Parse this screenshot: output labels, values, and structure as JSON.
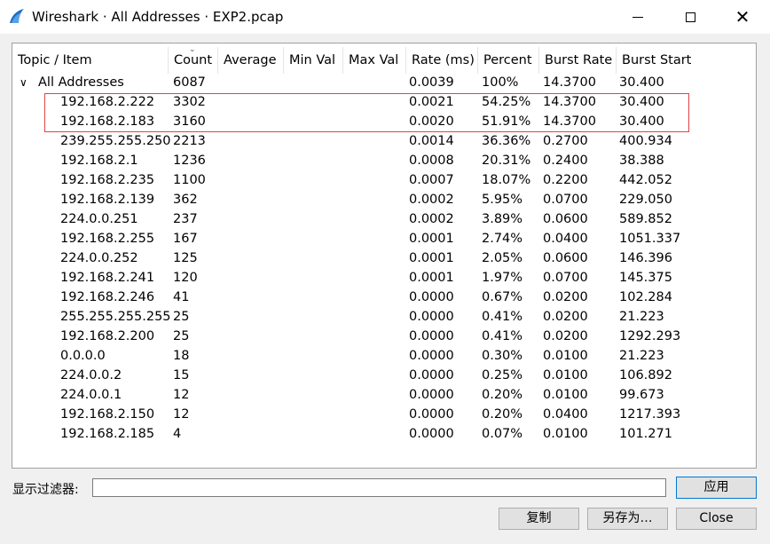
{
  "window": {
    "title": "Wireshark · All Addresses · EXP2.pcap",
    "icon": "wireshark-fin-icon",
    "controls": {
      "minimize": "minimize-icon",
      "maximize": "maximize-icon",
      "close_glyph": "✕"
    }
  },
  "table": {
    "columns": [
      "Topic / Item",
      "Count",
      "Average",
      "Min Val",
      "Max Val",
      "Rate (ms)",
      "Percent",
      "Burst Rate",
      "Burst Start"
    ],
    "root": {
      "expander": "∨",
      "item": "All Addresses",
      "count": "6087",
      "rate": "0.0039",
      "percent": "100%",
      "burst_rate": "14.3700",
      "burst_start": "30.400"
    },
    "rows": [
      {
        "item": "192.168.2.222",
        "count": "3302",
        "rate": "0.0021",
        "percent": "54.25%",
        "burst_rate": "14.3700",
        "burst_start": "30.400"
      },
      {
        "item": "192.168.2.183",
        "count": "3160",
        "rate": "0.0020",
        "percent": "51.91%",
        "burst_rate": "14.3700",
        "burst_start": "30.400"
      },
      {
        "item": "239.255.255.250",
        "count": "2213",
        "rate": "0.0014",
        "percent": "36.36%",
        "burst_rate": "0.2700",
        "burst_start": "400.934"
      },
      {
        "item": "192.168.2.1",
        "count": "1236",
        "rate": "0.0008",
        "percent": "20.31%",
        "burst_rate": "0.2400",
        "burst_start": "38.388"
      },
      {
        "item": "192.168.2.235",
        "count": "1100",
        "rate": "0.0007",
        "percent": "18.07%",
        "burst_rate": "0.2200",
        "burst_start": "442.052"
      },
      {
        "item": "192.168.2.139",
        "count": "362",
        "rate": "0.0002",
        "percent": "5.95%",
        "burst_rate": "0.0700",
        "burst_start": "229.050"
      },
      {
        "item": "224.0.0.251",
        "count": "237",
        "rate": "0.0002",
        "percent": "3.89%",
        "burst_rate": "0.0600",
        "burst_start": "589.852"
      },
      {
        "item": "192.168.2.255",
        "count": "167",
        "rate": "0.0001",
        "percent": "2.74%",
        "burst_rate": "0.0400",
        "burst_start": "1051.337"
      },
      {
        "item": "224.0.0.252",
        "count": "125",
        "rate": "0.0001",
        "percent": "2.05%",
        "burst_rate": "0.0600",
        "burst_start": "146.396"
      },
      {
        "item": "192.168.2.241",
        "count": "120",
        "rate": "0.0001",
        "percent": "1.97%",
        "burst_rate": "0.0700",
        "burst_start": "145.375"
      },
      {
        "item": "192.168.2.246",
        "count": "41",
        "rate": "0.0000",
        "percent": "0.67%",
        "burst_rate": "0.0200",
        "burst_start": "102.284"
      },
      {
        "item": "255.255.255.255",
        "count": "25",
        "rate": "0.0000",
        "percent": "0.41%",
        "burst_rate": "0.0200",
        "burst_start": "21.223"
      },
      {
        "item": "192.168.2.200",
        "count": "25",
        "rate": "0.0000",
        "percent": "0.41%",
        "burst_rate": "0.0200",
        "burst_start": "1292.293"
      },
      {
        "item": "0.0.0.0",
        "count": "18",
        "rate": "0.0000",
        "percent": "0.30%",
        "burst_rate": "0.0100",
        "burst_start": "21.223"
      },
      {
        "item": "224.0.0.2",
        "count": "15",
        "rate": "0.0000",
        "percent": "0.25%",
        "burst_rate": "0.0100",
        "burst_start": "106.892"
      },
      {
        "item": "224.0.0.1",
        "count": "12",
        "rate": "0.0000",
        "percent": "0.20%",
        "burst_rate": "0.0100",
        "burst_start": "99.673"
      },
      {
        "item": "192.168.2.150",
        "count": "12",
        "rate": "0.0000",
        "percent": "0.20%",
        "burst_rate": "0.0400",
        "burst_start": "1217.393"
      },
      {
        "item": "192.168.2.185",
        "count": "4",
        "rate": "0.0000",
        "percent": "0.07%",
        "burst_rate": "0.0100",
        "burst_start": "101.271"
      }
    ],
    "highlight_color": "#e04545"
  },
  "filter": {
    "label": "显示过滤器:",
    "value": "",
    "placeholder": ""
  },
  "buttons": {
    "apply": "应用",
    "copy": "复制",
    "save_as": "另存为…",
    "close": "Close"
  },
  "colors": {
    "accent": "#0078d7",
    "fin": "#1f6fc5"
  }
}
